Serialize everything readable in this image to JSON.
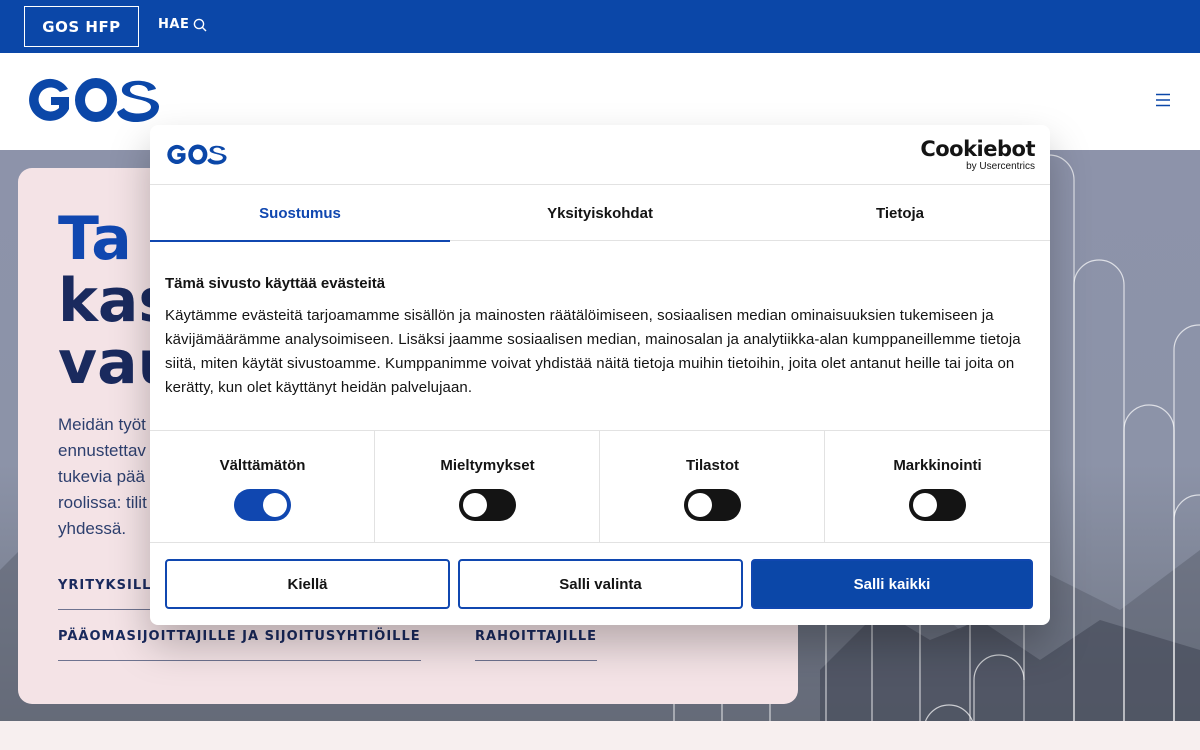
{
  "topbar": {
    "brand_label": "GOS HFP",
    "search_label": "HAE"
  },
  "hero": {
    "title_lines": [
      "Ta",
      "kas",
      "vau"
    ],
    "text": "Meidän työt\nennustettav\ntukevia pää\nroolissa: tilit\nyhdessä.",
    "links": [
      "YRITYKSILL",
      "PÄÄOMASIJOITTAJILLE JA SIJOITUSYHTIÖILLE",
      "RAHOITTAJILLE"
    ]
  },
  "dialog": {
    "cookiebot_main": "Cookiebot",
    "cookiebot_sub": "by Usercentrics",
    "tabs": [
      "Suostumus",
      "Yksityiskohdat",
      "Tietoja"
    ],
    "heading": "Tämä sivusto käyttää evästeitä",
    "body": "Käytämme evästeitä tarjoamamme sisällön ja mainosten räätälöimiseen, sosiaalisen median ominaisuuksien tukemiseen ja kävijämäärämme analysoimiseen. Lisäksi jaamme sosiaalisen median, mainosalan ja analytiikka-alan kumppaneillemme tietoja siitä, miten käytät sivustoamme. Kumppanimme voivat yhdistää näitä tietoja muihin tietoihin, joita olet antanut heille tai joita on kerätty, kun olet käyttänyt heidän palvelujaan.",
    "toggles": [
      {
        "label": "Välttämätön",
        "on": true
      },
      {
        "label": "Mieltymykset",
        "on": false
      },
      {
        "label": "Tilastot",
        "on": false
      },
      {
        "label": "Markkinointi",
        "on": false
      }
    ],
    "buttons": {
      "deny": "Kiellä",
      "allow_selection": "Salli valinta",
      "allow_all": "Salli kaikki"
    }
  },
  "colors": {
    "brand_blue": "#0b47a8",
    "accent_blue": "#1047b0",
    "hero_card": "#f4e3e6"
  },
  "icons": {
    "search": "search-icon",
    "menu": "hamburger-menu-icon"
  }
}
